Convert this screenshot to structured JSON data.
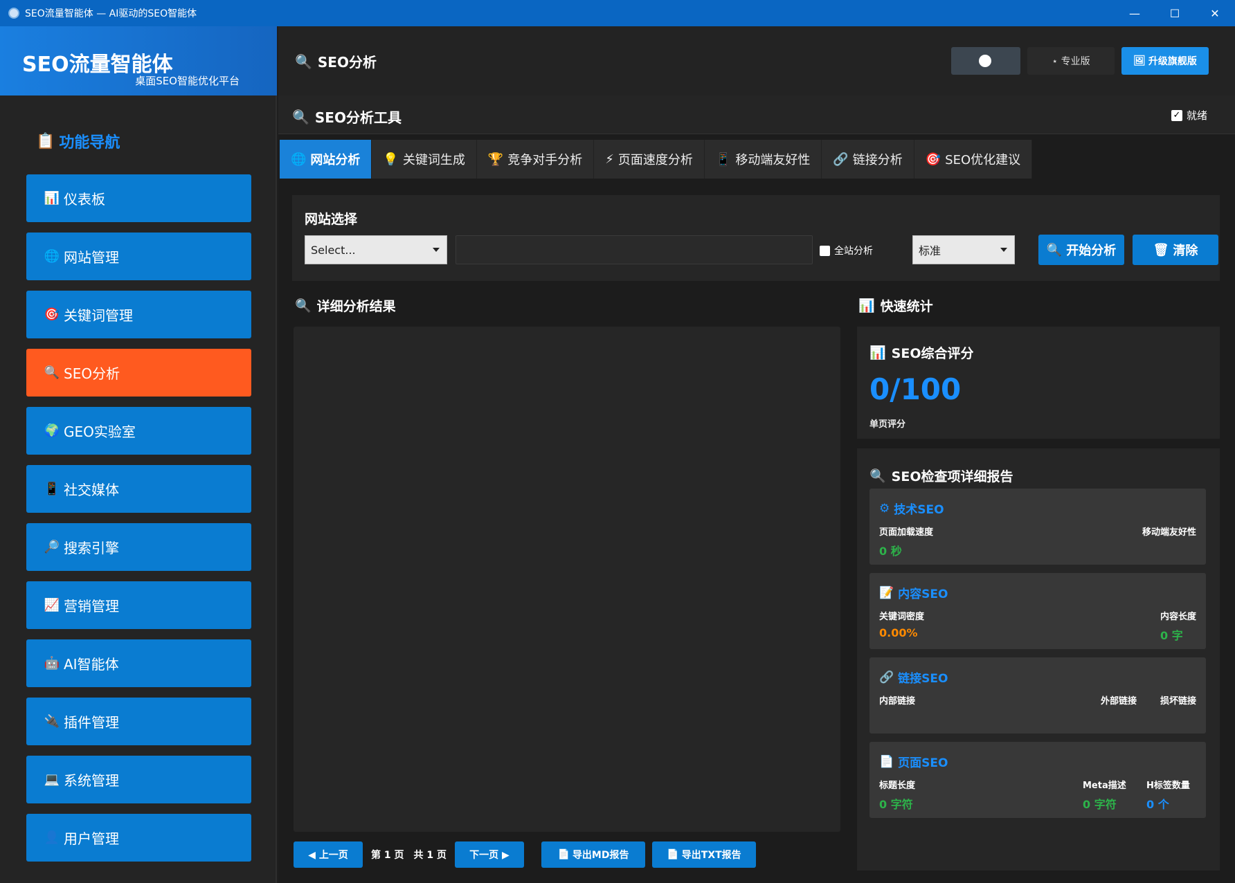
{
  "window": {
    "title": "SEO流量智能体 — AI驱动的SEO智能体",
    "minimize": "—",
    "maximize": "☐",
    "close": "✕"
  },
  "brand": {
    "name": "SEO流量智能体",
    "subtitle": "桌面SEO智能优化平台"
  },
  "nav": {
    "heading": "功能导航",
    "items": [
      {
        "label": "仪表板",
        "icon": "📊"
      },
      {
        "label": "网站管理",
        "icon": "🌐"
      },
      {
        "label": "关键词管理",
        "icon": "🎯"
      },
      {
        "label": "SEO分析",
        "icon": "🔍"
      },
      {
        "label": "GEO实验室",
        "icon": "🌍"
      },
      {
        "label": "社交媒体",
        "icon": "📱"
      },
      {
        "label": "搜索引擎",
        "icon": "🔎"
      },
      {
        "label": "营销管理",
        "icon": "📈"
      },
      {
        "label": "AI智能体",
        "icon": "🤖"
      },
      {
        "label": "插件管理",
        "icon": "🔌"
      },
      {
        "label": "系统管理",
        "icon": "💻"
      },
      {
        "label": "用户管理",
        "icon": "👤"
      }
    ]
  },
  "header": {
    "title": "SEO分析",
    "edition": "⋆ 专业版",
    "upgrade": "升级旗舰版"
  },
  "tool": {
    "title": "SEO分析工具",
    "status": "就绪"
  },
  "tabs": [
    {
      "label": "网站分析",
      "icon": "🌐"
    },
    {
      "label": "关键词生成",
      "icon": "💡"
    },
    {
      "label": "竞争对手分析",
      "icon": "🏆"
    },
    {
      "label": "页面速度分析",
      "icon": "⚡"
    },
    {
      "label": "移动端友好性",
      "icon": "📱"
    },
    {
      "label": "链接分析",
      "icon": "🔗"
    },
    {
      "label": "SEO优化建议",
      "icon": "🎯"
    }
  ],
  "site": {
    "label": "网站选择",
    "select_value": "Select...",
    "url_value": "",
    "full_site": "全站分析",
    "mode": "标准",
    "start": "开始分析",
    "clear": "清除"
  },
  "results": {
    "title": "详细分析结果",
    "prev": "◀ 上一页",
    "page": "第 1 页",
    "total": "共 1 页",
    "next": "下一页 ▶",
    "export_md": "导出MD报告",
    "export_txt": "导出TXT报告"
  },
  "stats": {
    "title": "快速统计",
    "score_title": "SEO综合评分",
    "score": "0/100",
    "score_caption": "单页评分",
    "report_title": "SEO检查项详细报告",
    "tech": {
      "title": "技术SEO",
      "m1": "页面加载速度",
      "v1": "0 秒",
      "m2": "移动端友好性",
      "v2": ""
    },
    "content": {
      "title": "内容SEO",
      "m1": "关键词密度",
      "v1": "0.00%",
      "m2": "内容长度",
      "v2": "0 字"
    },
    "links": {
      "title": "链接SEO",
      "m1": "内部链接",
      "m2": "外部链接",
      "m3": "损坏链接"
    },
    "page": {
      "title": "页面SEO",
      "m1": "标题长度",
      "v1": "0 字符",
      "m2": "Meta描述",
      "v2": "0 字符",
      "m3": "H标签数量",
      "v3": "0 个"
    }
  },
  "colors": {
    "accent": "#0a7cd1",
    "active": "#ff5a1f",
    "score": "#1a8fff",
    "ok": "#2db34a",
    "warn": "#ff8a00"
  }
}
